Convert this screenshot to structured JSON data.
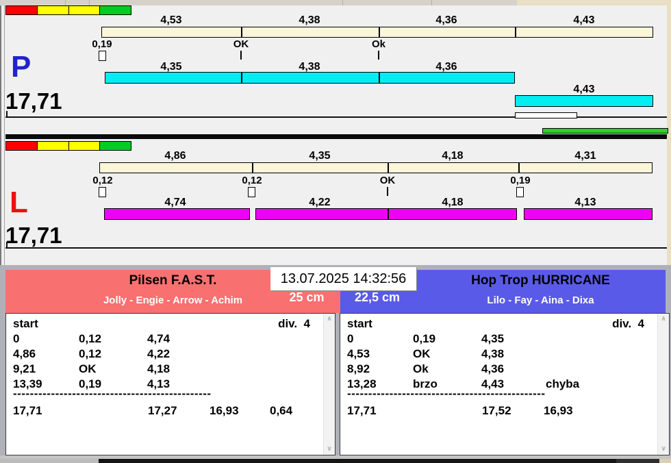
{
  "lanes": {
    "p": {
      "letter": "P",
      "total": "17,71",
      "split_times": [
        "4,53",
        "4,38",
        "4,36",
        "4,43"
      ],
      "change_marks": [
        "0,19",
        "OK",
        "Ok"
      ],
      "dog_times": [
        "4,35",
        "4,38",
        "4,36",
        "4,43"
      ]
    },
    "l": {
      "letter": "L",
      "total": "17,71",
      "split_times": [
        "4,86",
        "4,35",
        "4,18",
        "4,31"
      ],
      "change_marks": [
        "0,12",
        "0,12",
        "OK",
        "0,19"
      ],
      "dog_times": [
        "4,74",
        "4,22",
        "4,18",
        "4,13"
      ]
    }
  },
  "scoreboard": {
    "timestamp": "13.07.2025 14:32:56",
    "left": {
      "team": "Pilsen F.A.S.T.",
      "dogs": "Jolly - Engie - Arrow - Achim",
      "jump_height": "25 cm",
      "start_label": "start",
      "division": "div.  4",
      "rows": [
        [
          "0",
          "0,12",
          "4,74"
        ],
        [
          "4,86",
          "0,12",
          "4,22"
        ],
        [
          "9,21",
          "OK",
          "4,18"
        ],
        [
          "13,39",
          "0,19",
          "4,13"
        ]
      ],
      "separator": "-----------------------------------------------",
      "totals": [
        "17,71",
        "17,27",
        "16,93",
        "0,64"
      ]
    },
    "right": {
      "team": "Hop Trop HURRICANE",
      "dogs": "Lilo - Fay - Aina - Dixa",
      "jump_height": "22,5 cm",
      "start_label": "start",
      "division": "div.  4",
      "rows": [
        [
          "0",
          "0,19",
          "4,35"
        ],
        [
          "4,53",
          "OK",
          "4,38"
        ],
        [
          "8,92",
          "Ok",
          "4,36"
        ],
        [
          "13,28",
          "brzo",
          "4,43",
          "chyba"
        ]
      ],
      "separator": "-----------------------------------------------",
      "totals": [
        "17,71",
        "17,52",
        "16,93"
      ]
    }
  },
  "colors": {
    "lane_p_letter": "#2222d0",
    "lane_l_letter": "#ee1111",
    "split_bar": "#fbf6d9",
    "p_dog_bar": "#00eef2",
    "l_dog_bar": "#f000f0",
    "start_lights": [
      "#ff0000",
      "#ffff00",
      "#ffff00",
      "#00cc22"
    ],
    "progress_green": "#2cd32c",
    "left_header": "#f87070",
    "right_header": "#5a5ae8"
  }
}
